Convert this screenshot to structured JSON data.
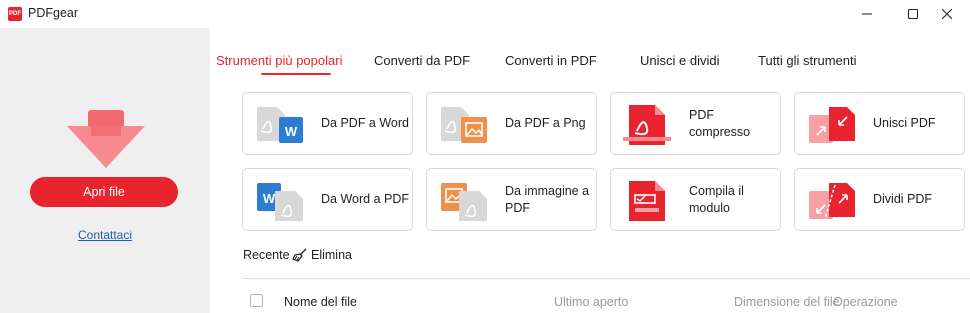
{
  "window": {
    "title": "PDFgear",
    "logo_text": "PDF"
  },
  "sidebar": {
    "open_button": "Apri file",
    "contact_link": "Contattaci"
  },
  "tabs": [
    {
      "label": "Strumenti più popolari",
      "active": true
    },
    {
      "label": "Converti da PDF",
      "active": false
    },
    {
      "label": "Converti in PDF",
      "active": false
    },
    {
      "label": "Unisci e dividi",
      "active": false
    },
    {
      "label": "Tutti gli strumenti",
      "active": false
    }
  ],
  "tools": [
    {
      "label": "Da PDF a Word",
      "icon": "pdf-to-word-icon"
    },
    {
      "label": "Da PDF a Png",
      "icon": "pdf-to-png-icon"
    },
    {
      "label": "PDF compresso",
      "icon": "compress-pdf-icon"
    },
    {
      "label": "Unisci PDF",
      "icon": "merge-pdf-icon"
    },
    {
      "label": "Da Word a PDF",
      "icon": "word-to-pdf-icon"
    },
    {
      "label": "Da immagine a PDF",
      "icon": "image-to-pdf-icon"
    },
    {
      "label": "Compila il modulo",
      "icon": "fill-form-icon"
    },
    {
      "label": "Dividi PDF",
      "icon": "split-pdf-icon"
    }
  ],
  "recent": {
    "title": "Recente",
    "delete_label": "Elimina",
    "columns": {
      "name": "Nome del file",
      "last_opened": "Ultimo aperto",
      "size": "Dimensione del file",
      "operation": "Operazione"
    }
  },
  "colors": {
    "accent": "#e8242e",
    "word_blue": "#2b7cd3",
    "image_orange": "#f0904a",
    "link_blue": "#1a5fb4"
  }
}
